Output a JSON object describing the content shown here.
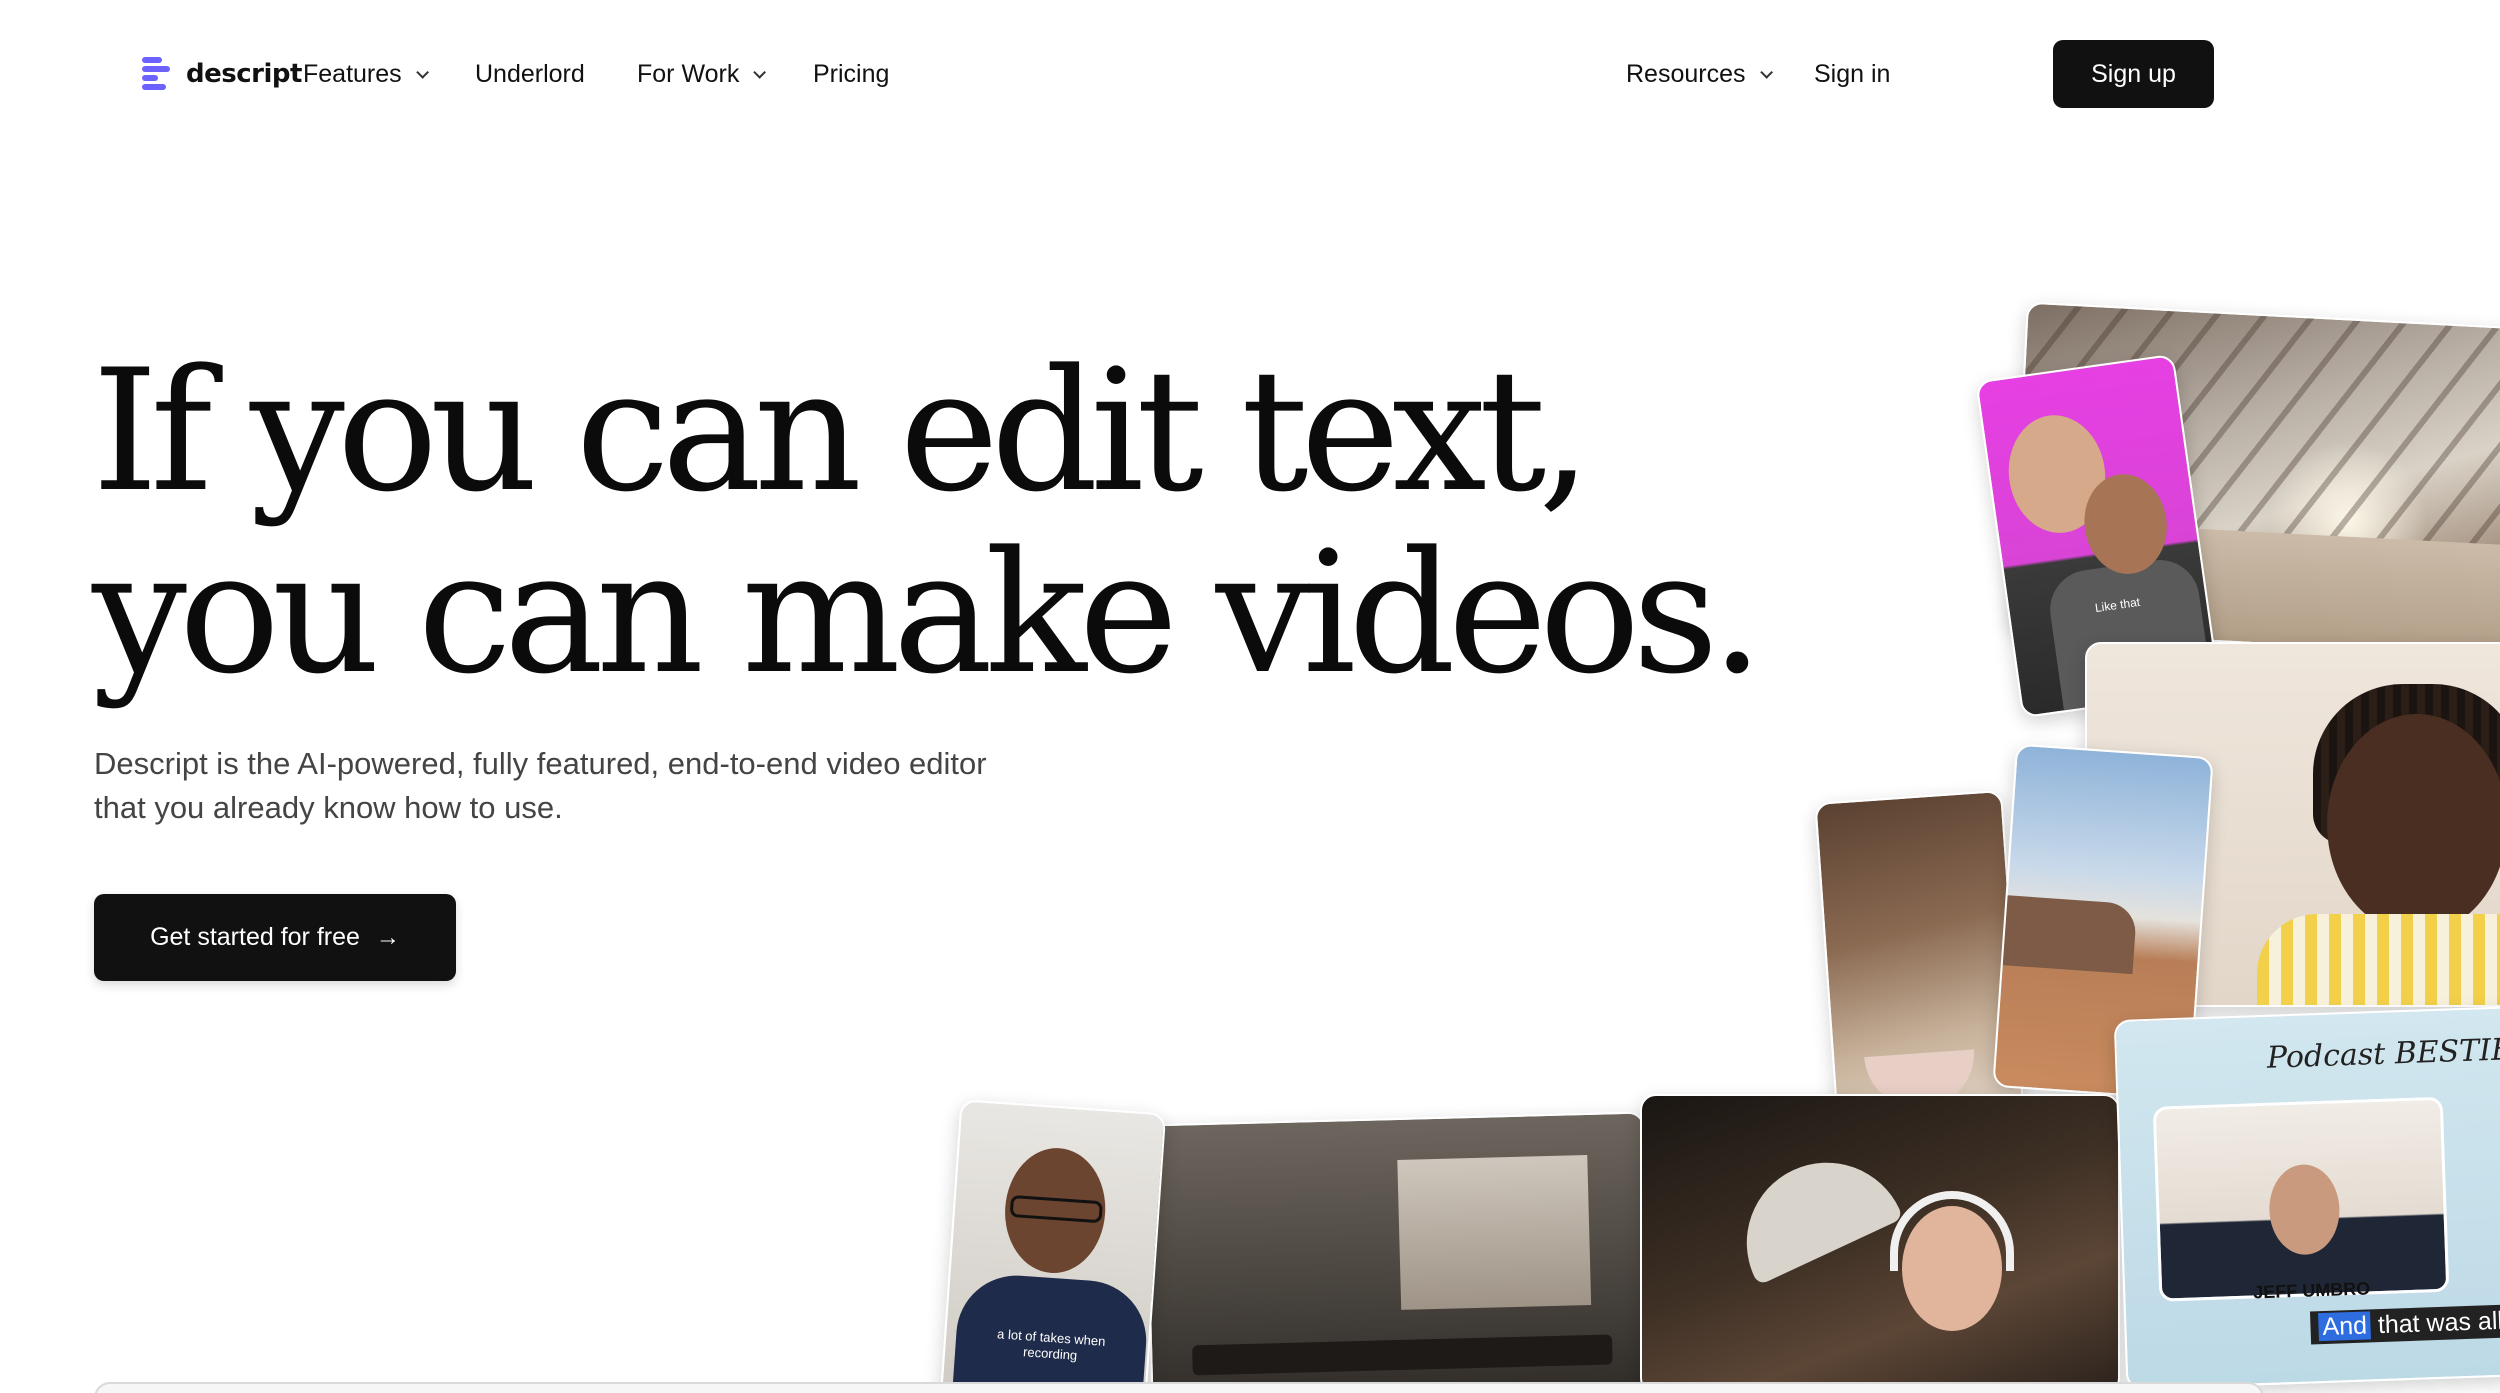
{
  "brand": {
    "name": "descript"
  },
  "nav": {
    "left_items": [
      {
        "label": "Features",
        "has_dropdown": true
      },
      {
        "label": "Underlord",
        "has_dropdown": false
      },
      {
        "label": "For Work",
        "has_dropdown": true
      },
      {
        "label": "Pricing",
        "has_dropdown": false
      }
    ],
    "resources": {
      "label": "Resources",
      "has_dropdown": true
    },
    "sign_in": "Sign in",
    "sign_up": "Sign up"
  },
  "hero": {
    "headline_line1": "If you can edit text,",
    "headline_line2": "you can make videos.",
    "subhead_line1": "Descript is the AI-powered, fully featured, end-to-end video editor",
    "subhead_line2": "that you already know how to use.",
    "cta_label": "Get started for free",
    "cta_icon": "arrow-right-icon"
  },
  "collage": {
    "duo_caption": "Like that",
    "podcast_logo": "Podcast BESTIE",
    "podcast_speaker": "JEFF UMBRO",
    "podcast_caption_highlight": "And",
    "podcast_caption_rest": " that was all sh",
    "man_caption": "a lot of takes when recording"
  },
  "colors": {
    "brand_accent": "#6c63ff",
    "button_dark": "#111111",
    "text_primary": "#0b0b0b",
    "text_secondary": "#444444"
  }
}
